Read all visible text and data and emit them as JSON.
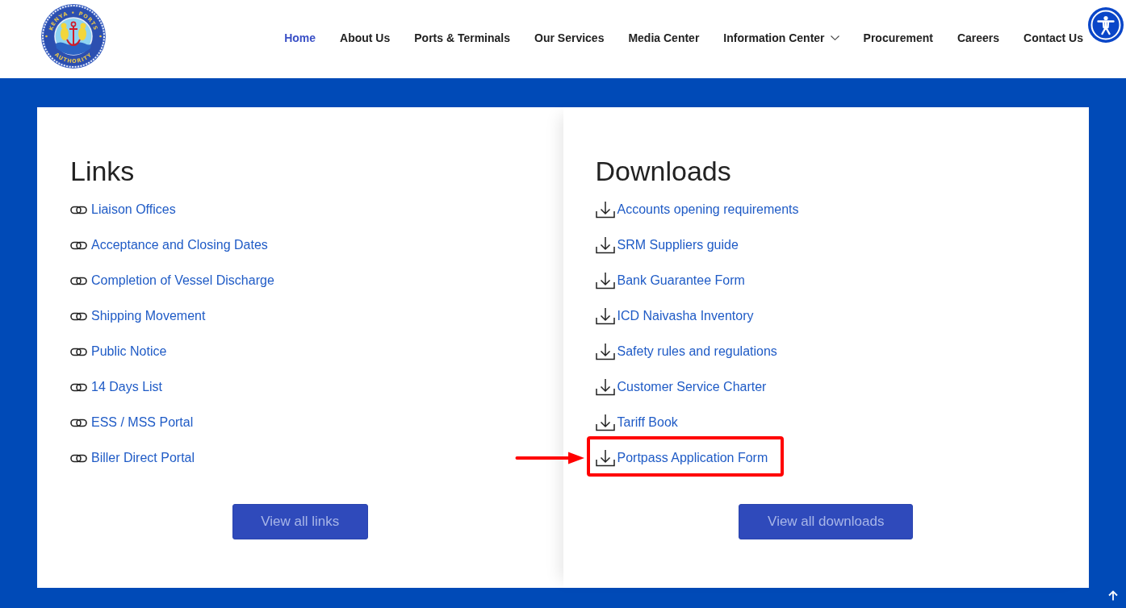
{
  "header": {
    "logo": {
      "top_text": "KENYA • PORTS",
      "bottom_text": "AUTHORITY"
    },
    "nav": [
      {
        "label": "Home",
        "selected": true,
        "dropdown": false
      },
      {
        "label": "About Us",
        "selected": false,
        "dropdown": false
      },
      {
        "label": "Ports & Terminals",
        "selected": false,
        "dropdown": false
      },
      {
        "label": "Our Services",
        "selected": false,
        "dropdown": false
      },
      {
        "label": "Media Center",
        "selected": false,
        "dropdown": false
      },
      {
        "label": "Information Center",
        "selected": false,
        "dropdown": true
      },
      {
        "label": "Procurement",
        "selected": false,
        "dropdown": false
      },
      {
        "label": "Careers",
        "selected": false,
        "dropdown": false
      },
      {
        "label": "Contact Us",
        "selected": false,
        "dropdown": false
      }
    ]
  },
  "links": {
    "title": "Links",
    "items": [
      "Liaison Offices",
      "Acceptance and Closing Dates",
      "Completion of Vessel Discharge",
      "Shipping Movement",
      "Public Notice",
      "14 Days List",
      "ESS / MSS Portal",
      "Biller Direct Portal"
    ],
    "button": "View all links"
  },
  "downloads": {
    "title": "Downloads",
    "items": [
      {
        "label": "Accounts opening requirements",
        "highlighted": false
      },
      {
        "label": "SRM Suppliers guide",
        "highlighted": false
      },
      {
        "label": "Bank Guarantee Form",
        "highlighted": false
      },
      {
        "label": "ICD Naivasha Inventory",
        "highlighted": false
      },
      {
        "label": "Safety rules and regulations",
        "highlighted": false
      },
      {
        "label": "Customer Service Charter",
        "highlighted": false
      },
      {
        "label": "Tariff Book",
        "highlighted": false
      },
      {
        "label": "Portpass Application Form",
        "highlighted": true
      }
    ],
    "button": "View all downloads"
  }
}
